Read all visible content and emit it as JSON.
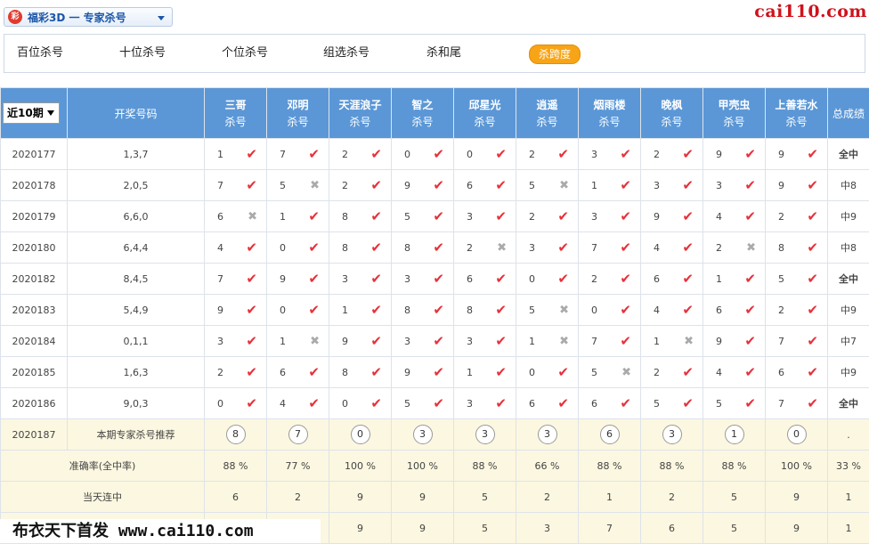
{
  "header": {
    "product_icon_text": "彩",
    "product_label": "福彩3D 一 专家杀号",
    "site_logo": "cai110.com"
  },
  "nav": {
    "tabs": [
      "百位杀号",
      "十位杀号",
      "个位杀号",
      "组选杀号",
      "杀和尾",
      "杀跨度"
    ],
    "active_index": 5
  },
  "table": {
    "period_select": "近10期",
    "draw_header": "开奖号码",
    "sub_label": "杀号",
    "experts": [
      "三哥",
      "邓明",
      "天涯浪子",
      "智之",
      "邱星光",
      "逍遥",
      "烟雨楼",
      "晚枫",
      "甲壳虫",
      "上善若水"
    ],
    "total_header": "总成绩",
    "rows": [
      {
        "period": "2020177",
        "draw": "1,3,7",
        "kills": [
          [
            "1",
            true
          ],
          [
            "7",
            true
          ],
          [
            "2",
            true
          ],
          [
            "0",
            true
          ],
          [
            "0",
            true
          ],
          [
            "2",
            true
          ],
          [
            "3",
            true
          ],
          [
            "2",
            true
          ],
          [
            "9",
            true
          ],
          [
            "9",
            true
          ]
        ],
        "result": "全中",
        "full": true
      },
      {
        "period": "2020178",
        "draw": "2,0,5",
        "kills": [
          [
            "7",
            true
          ],
          [
            "5",
            false
          ],
          [
            "2",
            true
          ],
          [
            "9",
            true
          ],
          [
            "6",
            true
          ],
          [
            "5",
            false
          ],
          [
            "1",
            true
          ],
          [
            "3",
            true
          ],
          [
            "3",
            true
          ],
          [
            "9",
            true
          ]
        ],
        "result": "中8",
        "full": false
      },
      {
        "period": "2020179",
        "draw": "6,6,0",
        "kills": [
          [
            "6",
            false
          ],
          [
            "1",
            true
          ],
          [
            "8",
            true
          ],
          [
            "5",
            true
          ],
          [
            "3",
            true
          ],
          [
            "2",
            true
          ],
          [
            "3",
            true
          ],
          [
            "9",
            true
          ],
          [
            "4",
            true
          ],
          [
            "2",
            true
          ]
        ],
        "result": "中9",
        "full": false
      },
      {
        "period": "2020180",
        "draw": "6,4,4",
        "kills": [
          [
            "4",
            true
          ],
          [
            "0",
            true
          ],
          [
            "8",
            true
          ],
          [
            "8",
            true
          ],
          [
            "2",
            false
          ],
          [
            "3",
            true
          ],
          [
            "7",
            true
          ],
          [
            "4",
            true
          ],
          [
            "2",
            false
          ],
          [
            "8",
            true
          ]
        ],
        "result": "中8",
        "full": false
      },
      {
        "period": "2020182",
        "draw": "8,4,5",
        "kills": [
          [
            "7",
            true
          ],
          [
            "9",
            true
          ],
          [
            "3",
            true
          ],
          [
            "3",
            true
          ],
          [
            "6",
            true
          ],
          [
            "0",
            true
          ],
          [
            "2",
            true
          ],
          [
            "6",
            true
          ],
          [
            "1",
            true
          ],
          [
            "5",
            true
          ]
        ],
        "result": "全中",
        "full": true
      },
      {
        "period": "2020183",
        "draw": "5,4,9",
        "kills": [
          [
            "9",
            true
          ],
          [
            "0",
            true
          ],
          [
            "1",
            true
          ],
          [
            "8",
            true
          ],
          [
            "8",
            true
          ],
          [
            "5",
            false
          ],
          [
            "0",
            true
          ],
          [
            "4",
            true
          ],
          [
            "6",
            true
          ],
          [
            "2",
            true
          ]
        ],
        "result": "中9",
        "full": false
      },
      {
        "period": "2020184",
        "draw": "0,1,1",
        "kills": [
          [
            "3",
            true
          ],
          [
            "1",
            false
          ],
          [
            "9",
            true
          ],
          [
            "3",
            true
          ],
          [
            "3",
            true
          ],
          [
            "1",
            false
          ],
          [
            "7",
            true
          ],
          [
            "1",
            false
          ],
          [
            "9",
            true
          ],
          [
            "7",
            true
          ]
        ],
        "result": "中7",
        "full": false
      },
      {
        "period": "2020185",
        "draw": "1,6,3",
        "kills": [
          [
            "2",
            true
          ],
          [
            "6",
            true
          ],
          [
            "8",
            true
          ],
          [
            "9",
            true
          ],
          [
            "1",
            true
          ],
          [
            "0",
            true
          ],
          [
            "5",
            false
          ],
          [
            "2",
            true
          ],
          [
            "4",
            true
          ],
          [
            "6",
            true
          ]
        ],
        "result": "中9",
        "full": false
      },
      {
        "period": "2020186",
        "draw": "9,0,3",
        "kills": [
          [
            "0",
            true
          ],
          [
            "4",
            true
          ],
          [
            "0",
            true
          ],
          [
            "5",
            true
          ],
          [
            "3",
            true
          ],
          [
            "6",
            true
          ],
          [
            "6",
            true
          ],
          [
            "5",
            true
          ],
          [
            "5",
            true
          ],
          [
            "7",
            true
          ]
        ],
        "result": "全中",
        "full": true
      }
    ],
    "recommend": {
      "period": "2020187",
      "label": "本期专家杀号推荐",
      "values": [
        "8",
        "7",
        "0",
        "3",
        "3",
        "3",
        "6",
        "3",
        "1",
        "0"
      ],
      "total": "."
    },
    "accuracy": {
      "label": "准确率(全中率)",
      "values": [
        "88 %",
        "77 %",
        "100 %",
        "100 %",
        "88 %",
        "66 %",
        "88 %",
        "88 %",
        "88 %",
        "100 %"
      ],
      "total": "33 %"
    },
    "streak": {
      "label": "当天连中",
      "values": [
        "6",
        "2",
        "9",
        "9",
        "5",
        "2",
        "1",
        "2",
        "5",
        "9"
      ],
      "total": "1"
    },
    "last_row": {
      "label": "",
      "values": [
        "",
        "",
        "9",
        "9",
        "5",
        "3",
        "7",
        "6",
        "5",
        "9"
      ],
      "total": "1"
    }
  },
  "watermark": "布衣天下首发 www.cai110.com",
  "colors": {
    "header_blue": "#5b97d6",
    "accent_red": "#ee1d23",
    "tab_orange": "#f7a416",
    "summary_bg": "#fcf7e0"
  },
  "icons": {
    "check": "check-icon",
    "cross": "cross-icon"
  }
}
